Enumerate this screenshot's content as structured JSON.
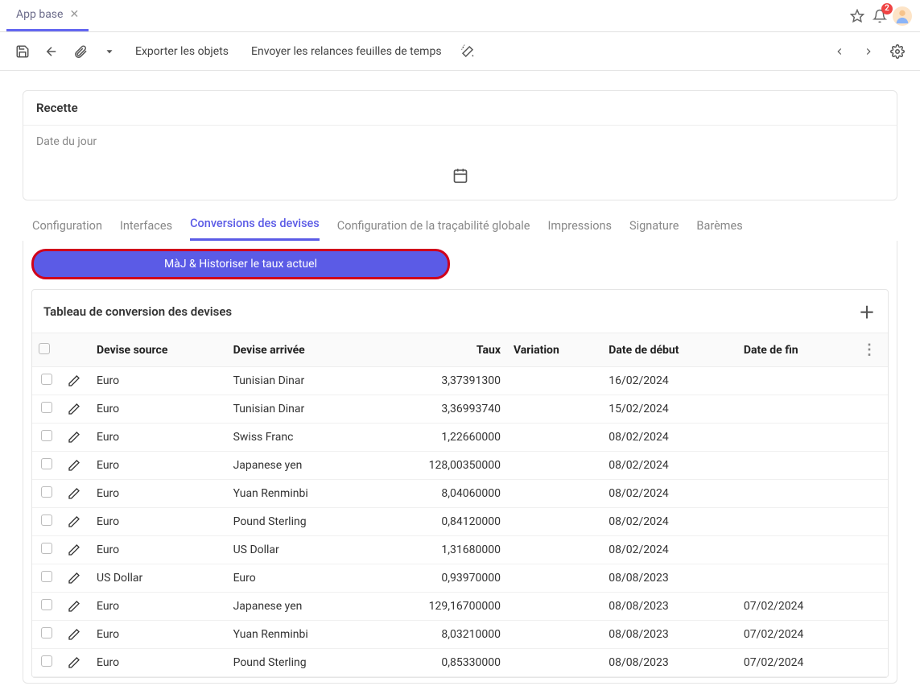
{
  "topTabs": {
    "appBase": "App base"
  },
  "notifications": {
    "count": "2"
  },
  "toolbar": {
    "exportLabel": "Exporter les objets",
    "sendTimesheetLabel": "Envoyer les relances feuilles de temps"
  },
  "recette": {
    "title": "Recette",
    "dateLabel": "Date du jour"
  },
  "tabs": {
    "configuration": "Configuration",
    "interfaces": "Interfaces",
    "conversions": "Conversions des devises",
    "tracabilite": "Configuration de la traçabilité globale",
    "impressions": "Impressions",
    "signature": "Signature",
    "baremes": "Barèmes"
  },
  "actions": {
    "majHistoriser": "MàJ & Historiser le taux actuel"
  },
  "table": {
    "title": "Tableau de conversion des devises",
    "headers": {
      "deviseSource": "Devise source",
      "deviseArrivee": "Devise arrivée",
      "taux": "Taux",
      "variation": "Variation",
      "dateDebut": "Date de début",
      "dateFin": "Date de fin"
    },
    "rows": [
      {
        "src": "Euro",
        "dst": "Tunisian Dinar",
        "taux": "3,37391300",
        "variation": "",
        "debut": "16/02/2024",
        "fin": ""
      },
      {
        "src": "Euro",
        "dst": "Tunisian Dinar",
        "taux": "3,36993740",
        "variation": "",
        "debut": "15/02/2024",
        "fin": ""
      },
      {
        "src": "Euro",
        "dst": "Swiss Franc",
        "taux": "1,22660000",
        "variation": "",
        "debut": "08/02/2024",
        "fin": ""
      },
      {
        "src": "Euro",
        "dst": "Japanese yen",
        "taux": "128,00350000",
        "variation": "",
        "debut": "08/02/2024",
        "fin": ""
      },
      {
        "src": "Euro",
        "dst": "Yuan Renminbi",
        "taux": "8,04060000",
        "variation": "",
        "debut": "08/02/2024",
        "fin": ""
      },
      {
        "src": "Euro",
        "dst": "Pound Sterling",
        "taux": "0,84120000",
        "variation": "",
        "debut": "08/02/2024",
        "fin": ""
      },
      {
        "src": "Euro",
        "dst": "US Dollar",
        "taux": "1,31680000",
        "variation": "",
        "debut": "08/02/2024",
        "fin": ""
      },
      {
        "src": "US Dollar",
        "dst": "Euro",
        "taux": "0,93970000",
        "variation": "",
        "debut": "08/08/2023",
        "fin": ""
      },
      {
        "src": "Euro",
        "dst": "Japanese yen",
        "taux": "129,16700000",
        "variation": "",
        "debut": "08/08/2023",
        "fin": "07/02/2024"
      },
      {
        "src": "Euro",
        "dst": "Yuan Renminbi",
        "taux": "8,03210000",
        "variation": "",
        "debut": "08/08/2023",
        "fin": "07/02/2024"
      },
      {
        "src": "Euro",
        "dst": "Pound Sterling",
        "taux": "0,85330000",
        "variation": "",
        "debut": "08/08/2023",
        "fin": "07/02/2024"
      }
    ]
  }
}
